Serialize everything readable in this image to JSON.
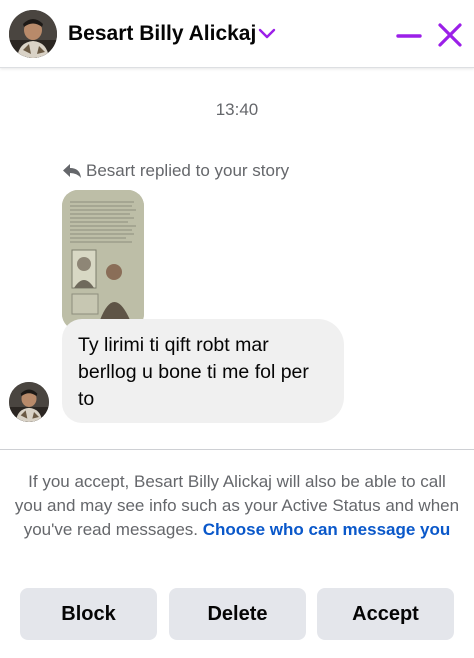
{
  "header": {
    "contact_name": "Besart Billy Alickaj",
    "icons": [
      "avatar",
      "chevron-down-icon",
      "minimize-icon",
      "close-icon"
    ],
    "accent_color": "#9b1fe8"
  },
  "thread": {
    "timestamp": "13:40",
    "reply_context": "Besart replied to your story",
    "message": "Ty lirimi ti qift robt mar berllog u bone ti me fol per to"
  },
  "request": {
    "notice_text": "If you accept, Besart Billy Alickaj will also be able to call you and may see info such as your Active Status and when you've read messages.",
    "notice_link": "Choose who can message you"
  },
  "actions": {
    "block": "Block",
    "delete": "Delete",
    "accept": "Accept"
  }
}
